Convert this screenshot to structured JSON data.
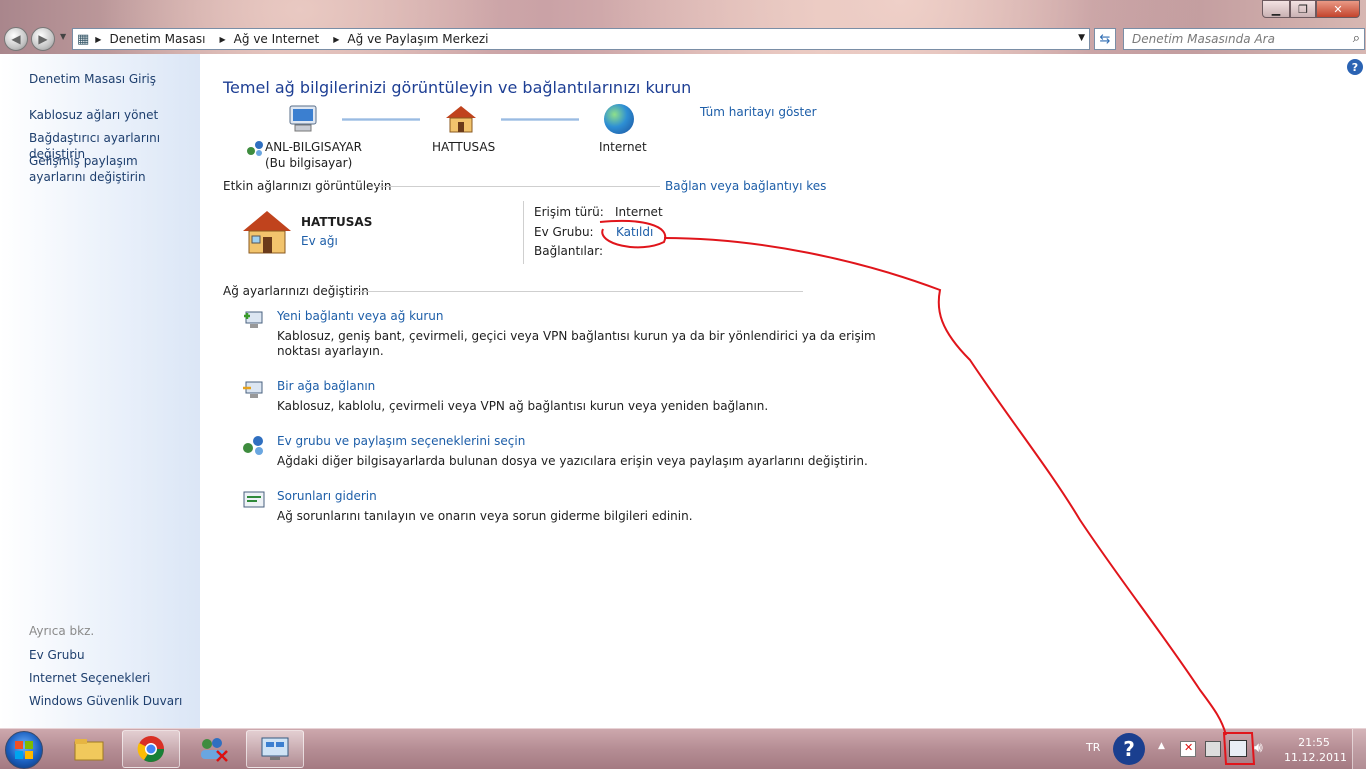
{
  "window": {
    "address_bar": {
      "crumbs": [
        "Denetim Masası",
        "Ağ ve Internet",
        "Ağ ve Paylaşım Merkezi"
      ]
    },
    "search": {
      "placeholder": "Denetim Masasında Ara"
    }
  },
  "sidebar": {
    "top_items": [
      {
        "label": "Denetim Masası Giriş"
      },
      {
        "label": "Kablosuz ağları yönet"
      },
      {
        "label": "Bağdaştırıcı ayarlarını değiştirin"
      },
      {
        "label": "Gelişmiş paylaşım ayarlarını değiştirin"
      }
    ],
    "see_also_title": "Ayrıca bkz.",
    "see_also": [
      {
        "label": "Ev Grubu"
      },
      {
        "label": "Internet Seçenekleri"
      },
      {
        "label": "Windows Güvenlik Duvarı"
      }
    ]
  },
  "main": {
    "heading": "Temel ağ bilgilerinizi görüntüleyin ve bağlantılarınızı kurun",
    "show_full_map": "Tüm haritayı göster",
    "map": {
      "computer_name": "ANL-BILGISAYAR",
      "computer_sub": "(Bu bilgisayar)",
      "network_name": "HATTUSAS",
      "internet_label": "Internet"
    },
    "active_networks_title": "Etkin ağlarınızı görüntüleyin",
    "connect_disconnect": "Bağlan veya bağlantıyı kes",
    "active_network": {
      "name": "HATTUSAS",
      "type": "Ev ağı",
      "access_type_label": "Erişim türü:",
      "access_type_value": "Internet",
      "homegroup_label": "Ev Grubu:",
      "homegroup_value": "Katıldı",
      "connections_label": "Bağlantılar:"
    },
    "change_settings_title": "Ağ ayarlarınızı değiştirin",
    "tasks": [
      {
        "icon": "new-connection-icon",
        "title": "Yeni bağlantı veya ağ kurun",
        "desc_line1": "Kablosuz, geniş bant, çevirmeli, geçici veya VPN bağlantısı kurun ya da bir yönlendirici ya da erişim",
        "desc_line2": "noktası ayarlayın."
      },
      {
        "icon": "connect-network-icon",
        "title": "Bir ağa bağlanın",
        "desc_line1": "Kablosuz, kablolu, çevirmeli veya VPN ağ bağlantısı kurun veya yeniden bağlanın.",
        "desc_line2": ""
      },
      {
        "icon": "homegroup-sharing-icon",
        "title": "Ev grubu ve paylaşım seçeneklerini seçin",
        "desc_line1": "Ağdaki diğer bilgisayarlarda bulunan dosya ve yazıcılara erişin veya paylaşım ayarlarını değiştirin.",
        "desc_line2": ""
      },
      {
        "icon": "troubleshoot-icon",
        "title": "Sorunları giderin",
        "desc_line1": "Ağ sorunlarını tanılayın ve onarın veya sorun giderme bilgileri edinin.",
        "desc_line2": ""
      }
    ]
  },
  "taskbar": {
    "language": "TR",
    "time": "21:55",
    "date": "11.12.2011"
  },
  "colors": {
    "link": "#1d5ea8",
    "heading": "#1e3f94",
    "annotation": "#e0151b"
  }
}
